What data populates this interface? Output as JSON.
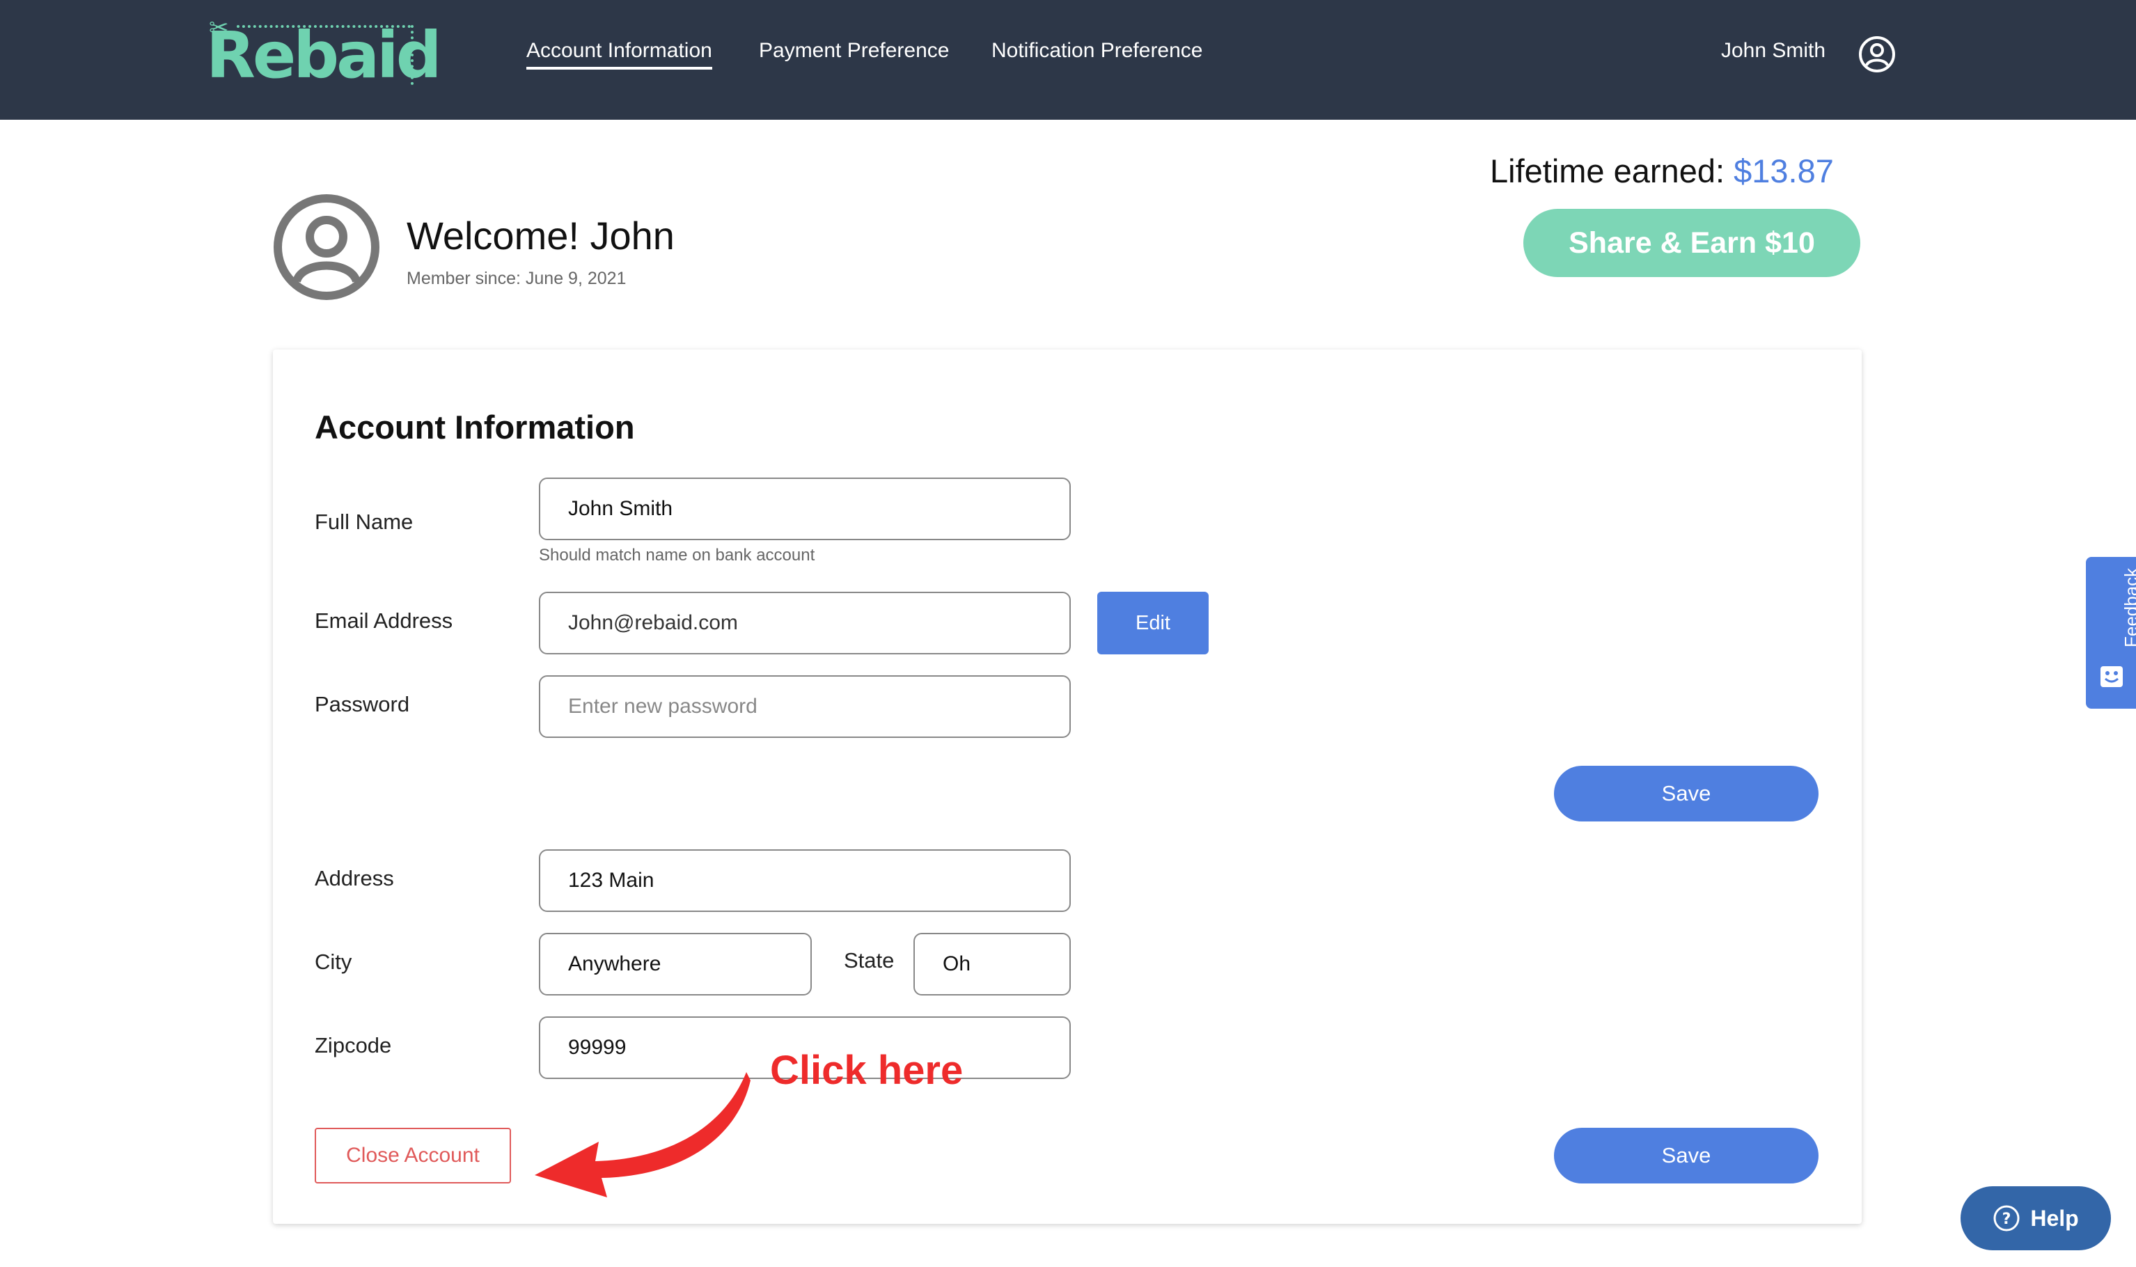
{
  "header": {
    "logo_text": "Rebaid",
    "nav": [
      {
        "label": "Account Information",
        "active": true
      },
      {
        "label": "Payment Preference",
        "active": false
      },
      {
        "label": "Notification Preference",
        "active": false
      }
    ],
    "user_name": "John Smith"
  },
  "welcome": {
    "title": "Welcome! John",
    "member_since": "Member since: June 9, 2021",
    "lifetime_label": "Lifetime earned: ",
    "lifetime_amount": "$13.87",
    "share_label": "Share & Earn $10"
  },
  "account": {
    "title": "Account Information",
    "full_name_label": "Full Name",
    "full_name_value": "John Smith",
    "full_name_hint": "Should match name on bank account",
    "email_label": "Email Address",
    "email_value": "John@rebaid.com",
    "edit_label": "Edit",
    "password_label": "Password",
    "password_placeholder": "Enter new password",
    "save_label": "Save",
    "address_label": "Address",
    "address_value": "123 Main",
    "city_label": "City",
    "city_value": "Anywhere",
    "state_label": "State",
    "state_value": "Oh",
    "zipcode_label": "Zipcode",
    "zipcode_value": "99999",
    "close_label": "Close Account"
  },
  "annotation": {
    "text": "Click here"
  },
  "widgets": {
    "feedback_label": "Feedback",
    "help_label": "Help"
  },
  "colors": {
    "header_bg": "#2d3748",
    "brand": "#6fd2b0",
    "accent": "#4f7fe0",
    "danger": "#e05a5a",
    "annotation": "#ee2b2b"
  },
  "icons": [
    "user-circle-icon",
    "scissors-icon",
    "feedback-icon",
    "question-icon",
    "arrow-icon"
  ]
}
